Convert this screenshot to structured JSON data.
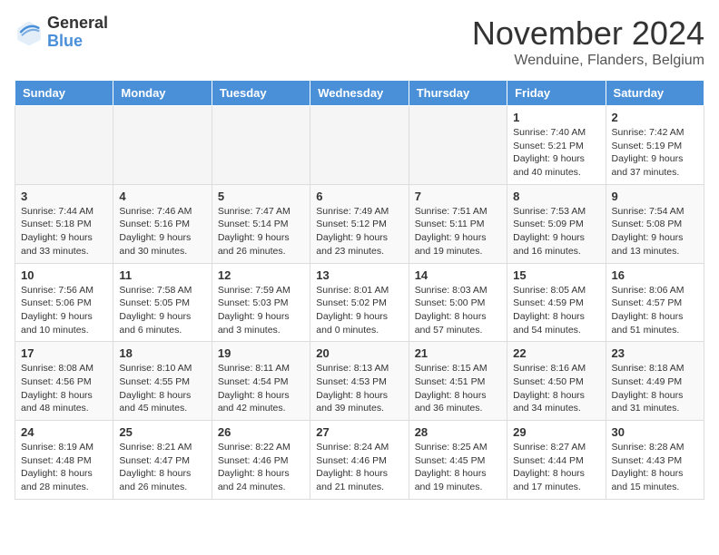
{
  "logo": {
    "general": "General",
    "blue": "Blue"
  },
  "title": "November 2024",
  "location": "Wenduine, Flanders, Belgium",
  "days_of_week": [
    "Sunday",
    "Monday",
    "Tuesday",
    "Wednesday",
    "Thursday",
    "Friday",
    "Saturday"
  ],
  "weeks": [
    [
      {
        "day": "",
        "info": ""
      },
      {
        "day": "",
        "info": ""
      },
      {
        "day": "",
        "info": ""
      },
      {
        "day": "",
        "info": ""
      },
      {
        "day": "",
        "info": ""
      },
      {
        "day": "1",
        "info": "Sunrise: 7:40 AM\nSunset: 5:21 PM\nDaylight: 9 hours and 40 minutes."
      },
      {
        "day": "2",
        "info": "Sunrise: 7:42 AM\nSunset: 5:19 PM\nDaylight: 9 hours and 37 minutes."
      }
    ],
    [
      {
        "day": "3",
        "info": "Sunrise: 7:44 AM\nSunset: 5:18 PM\nDaylight: 9 hours and 33 minutes."
      },
      {
        "day": "4",
        "info": "Sunrise: 7:46 AM\nSunset: 5:16 PM\nDaylight: 9 hours and 30 minutes."
      },
      {
        "day": "5",
        "info": "Sunrise: 7:47 AM\nSunset: 5:14 PM\nDaylight: 9 hours and 26 minutes."
      },
      {
        "day": "6",
        "info": "Sunrise: 7:49 AM\nSunset: 5:12 PM\nDaylight: 9 hours and 23 minutes."
      },
      {
        "day": "7",
        "info": "Sunrise: 7:51 AM\nSunset: 5:11 PM\nDaylight: 9 hours and 19 minutes."
      },
      {
        "day": "8",
        "info": "Sunrise: 7:53 AM\nSunset: 5:09 PM\nDaylight: 9 hours and 16 minutes."
      },
      {
        "day": "9",
        "info": "Sunrise: 7:54 AM\nSunset: 5:08 PM\nDaylight: 9 hours and 13 minutes."
      }
    ],
    [
      {
        "day": "10",
        "info": "Sunrise: 7:56 AM\nSunset: 5:06 PM\nDaylight: 9 hours and 10 minutes."
      },
      {
        "day": "11",
        "info": "Sunrise: 7:58 AM\nSunset: 5:05 PM\nDaylight: 9 hours and 6 minutes."
      },
      {
        "day": "12",
        "info": "Sunrise: 7:59 AM\nSunset: 5:03 PM\nDaylight: 9 hours and 3 minutes."
      },
      {
        "day": "13",
        "info": "Sunrise: 8:01 AM\nSunset: 5:02 PM\nDaylight: 9 hours and 0 minutes."
      },
      {
        "day": "14",
        "info": "Sunrise: 8:03 AM\nSunset: 5:00 PM\nDaylight: 8 hours and 57 minutes."
      },
      {
        "day": "15",
        "info": "Sunrise: 8:05 AM\nSunset: 4:59 PM\nDaylight: 8 hours and 54 minutes."
      },
      {
        "day": "16",
        "info": "Sunrise: 8:06 AM\nSunset: 4:57 PM\nDaylight: 8 hours and 51 minutes."
      }
    ],
    [
      {
        "day": "17",
        "info": "Sunrise: 8:08 AM\nSunset: 4:56 PM\nDaylight: 8 hours and 48 minutes."
      },
      {
        "day": "18",
        "info": "Sunrise: 8:10 AM\nSunset: 4:55 PM\nDaylight: 8 hours and 45 minutes."
      },
      {
        "day": "19",
        "info": "Sunrise: 8:11 AM\nSunset: 4:54 PM\nDaylight: 8 hours and 42 minutes."
      },
      {
        "day": "20",
        "info": "Sunrise: 8:13 AM\nSunset: 4:53 PM\nDaylight: 8 hours and 39 minutes."
      },
      {
        "day": "21",
        "info": "Sunrise: 8:15 AM\nSunset: 4:51 PM\nDaylight: 8 hours and 36 minutes."
      },
      {
        "day": "22",
        "info": "Sunrise: 8:16 AM\nSunset: 4:50 PM\nDaylight: 8 hours and 34 minutes."
      },
      {
        "day": "23",
        "info": "Sunrise: 8:18 AM\nSunset: 4:49 PM\nDaylight: 8 hours and 31 minutes."
      }
    ],
    [
      {
        "day": "24",
        "info": "Sunrise: 8:19 AM\nSunset: 4:48 PM\nDaylight: 8 hours and 28 minutes."
      },
      {
        "day": "25",
        "info": "Sunrise: 8:21 AM\nSunset: 4:47 PM\nDaylight: 8 hours and 26 minutes."
      },
      {
        "day": "26",
        "info": "Sunrise: 8:22 AM\nSunset: 4:46 PM\nDaylight: 8 hours and 24 minutes."
      },
      {
        "day": "27",
        "info": "Sunrise: 8:24 AM\nSunset: 4:46 PM\nDaylight: 8 hours and 21 minutes."
      },
      {
        "day": "28",
        "info": "Sunrise: 8:25 AM\nSunset: 4:45 PM\nDaylight: 8 hours and 19 minutes."
      },
      {
        "day": "29",
        "info": "Sunrise: 8:27 AM\nSunset: 4:44 PM\nDaylight: 8 hours and 17 minutes."
      },
      {
        "day": "30",
        "info": "Sunrise: 8:28 AM\nSunset: 4:43 PM\nDaylight: 8 hours and 15 minutes."
      }
    ]
  ]
}
